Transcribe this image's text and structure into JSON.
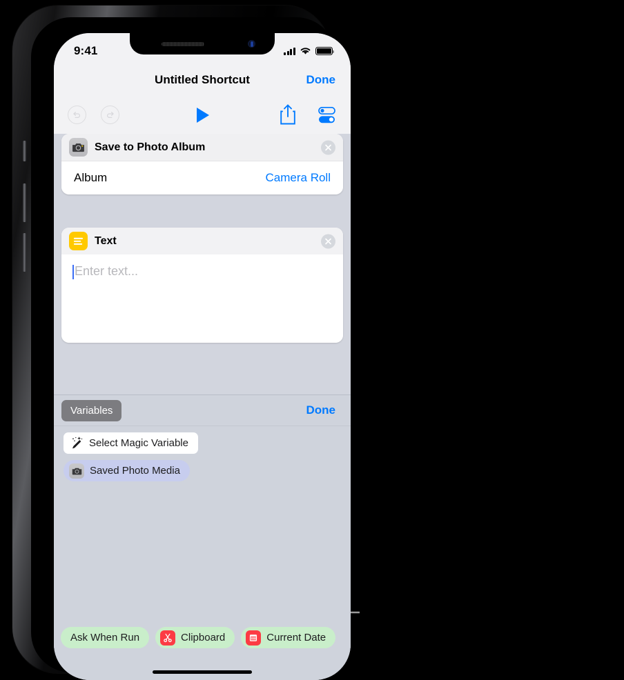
{
  "status_bar": {
    "time": "9:41",
    "signal_icon": "cellular-signal-icon",
    "wifi_icon": "wifi-icon",
    "battery_icon": "battery-full-icon"
  },
  "nav_bar": {
    "title": "Untitled Shortcut",
    "done_label": "Done"
  },
  "toolbar": {
    "undo_icon": "undo-icon",
    "redo_icon": "redo-icon",
    "play_icon": "play-icon",
    "share_icon": "share-icon",
    "settings_icon": "settings-toggles-icon"
  },
  "actions": [
    {
      "title": "Save to Photo Album",
      "icon": "camera-icon",
      "delete_icon": "close-circle-icon",
      "param_label": "Album",
      "param_value": "Camera Roll"
    },
    {
      "title": "Text",
      "icon": "text-lines-icon",
      "delete_icon": "close-circle-icon",
      "placeholder": "Enter text..."
    }
  ],
  "variables_panel": {
    "tab_label": "Variables",
    "done_label": "Done",
    "magic_variable": {
      "label": "Select Magic Variable",
      "icon": "magic-wand-icon"
    },
    "saved_variable": {
      "label": "Saved Photo Media",
      "icon": "camera-icon"
    },
    "bottom_chips": [
      {
        "label": "Ask When Run",
        "icon": null
      },
      {
        "label": "Clipboard",
        "icon": "scissors-icon"
      },
      {
        "label": "Current Date",
        "icon": "calendar-icon"
      }
    ]
  },
  "colors": {
    "accent_blue": "#007aff",
    "text_yellow": "#ffc900",
    "chip_green": "#c9eeca",
    "chip_lavender": "#c7cdee",
    "clipboard_red": "#fc3b44",
    "panel_gray": "#cfd3dc"
  }
}
